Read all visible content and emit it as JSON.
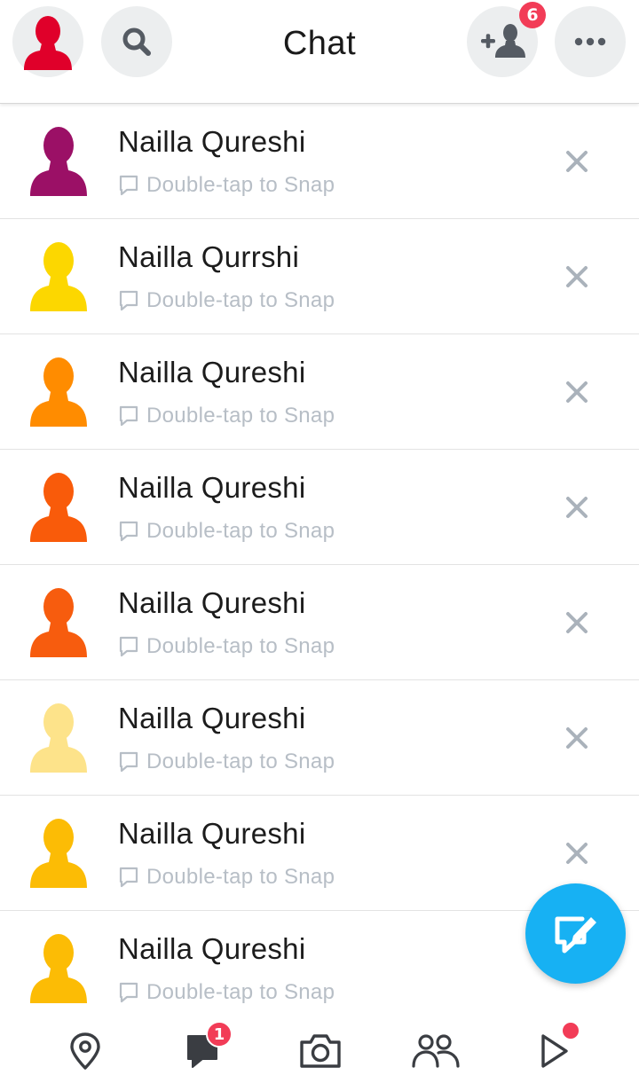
{
  "header": {
    "title": "Chat",
    "profile_icon": "profile-avatar-icon",
    "search_icon": "search-icon",
    "add_friend_icon": "add-friend-icon",
    "add_friend_badge": "6",
    "more_icon": "more-dots-icon"
  },
  "chats": [
    {
      "name": "Nailla Qureshi",
      "status": "Double-tap to Snap",
      "avatar_color": "#9b1066"
    },
    {
      "name": "Nailla Qurrshi",
      "status": "Double-tap to Snap",
      "avatar_color": "#fcd700"
    },
    {
      "name": "Nailla Qureshi",
      "status": "Double-tap to Snap",
      "avatar_color": "#ff8c00"
    },
    {
      "name": "Nailla Qureshi",
      "status": "Double-tap to Snap",
      "avatar_color": "#f95b0a"
    },
    {
      "name": "Nailla Qureshi",
      "status": "Double-tap to Snap",
      "avatar_color": "#f75c0e"
    },
    {
      "name": "Nailla Qureshi",
      "status": "Double-tap to Snap",
      "avatar_color": "#fde38a"
    },
    {
      "name": "Nailla Qureshi",
      "status": "Double-tap to Snap",
      "avatar_color": "#fcbc05"
    },
    {
      "name": "Nailla Qureshi",
      "status": "Double-tap to Snap",
      "avatar_color": "#fcbc05"
    }
  ],
  "fab_icon": "new-chat-icon",
  "bottom_nav": {
    "chat_badge": "1",
    "items": [
      "map-pin-icon",
      "chat-icon",
      "camera-icon",
      "friends-icon",
      "discover-play-icon"
    ]
  },
  "colors": {
    "accent": "#17b1f3",
    "badge": "#f23c57",
    "profile_avatar": "#e0002a"
  }
}
